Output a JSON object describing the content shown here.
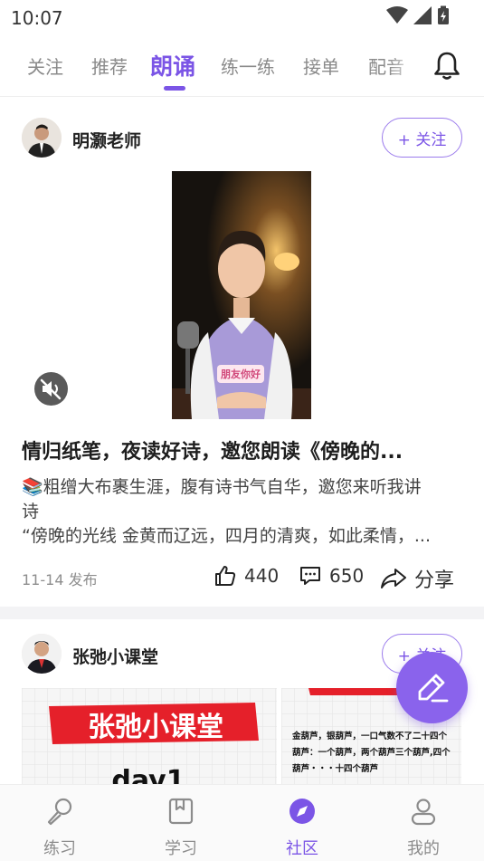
{
  "status_bar": {
    "time": "10:07"
  },
  "top_tabs": {
    "items": [
      "关注",
      "推荐",
      "朗诵",
      "练一练",
      "接单",
      "配音"
    ],
    "active": "朗诵"
  },
  "post1": {
    "author": "明灏老师",
    "follow_label": "+ 关注",
    "video_caption": "朋友你好",
    "title": "情归纸笔，夜读好诗，邀您朗读《傍晚的...",
    "desc_line1": "📚粗缯大布裹生涯，腹有诗书气自华，邀您来听我讲",
    "desc_line2": "诗",
    "desc_line3": "“傍晚的光线 金黄而辽远，四月的清爽，如此柔情，...",
    "date": "11-14 发布",
    "likes": "440",
    "comments": "650",
    "share_label": "分享"
  },
  "post2": {
    "author": "张弛小课堂",
    "follow_label": "+ 关注",
    "img_left_title": "张弛小课堂",
    "img_left_sub": "day1",
    "img_right_text1": "金葫芦，银葫芦，一口气数不了二十四个",
    "img_right_text2": "葫芦：一个葫芦，两个葫芦三个葫芦,四个",
    "img_right_text3": "葫芦・・・十四个葫芦"
  },
  "bottom_nav": {
    "items": [
      {
        "label": "练习",
        "icon": "microphone-icon"
      },
      {
        "label": "学习",
        "icon": "book-icon"
      },
      {
        "label": "社区",
        "icon": "compass-icon"
      },
      {
        "label": "我的",
        "icon": "user-icon"
      }
    ],
    "active": "社区"
  },
  "colors": {
    "accent": "#7b55e6",
    "text": "#222222",
    "muted": "#8e8e8e"
  }
}
